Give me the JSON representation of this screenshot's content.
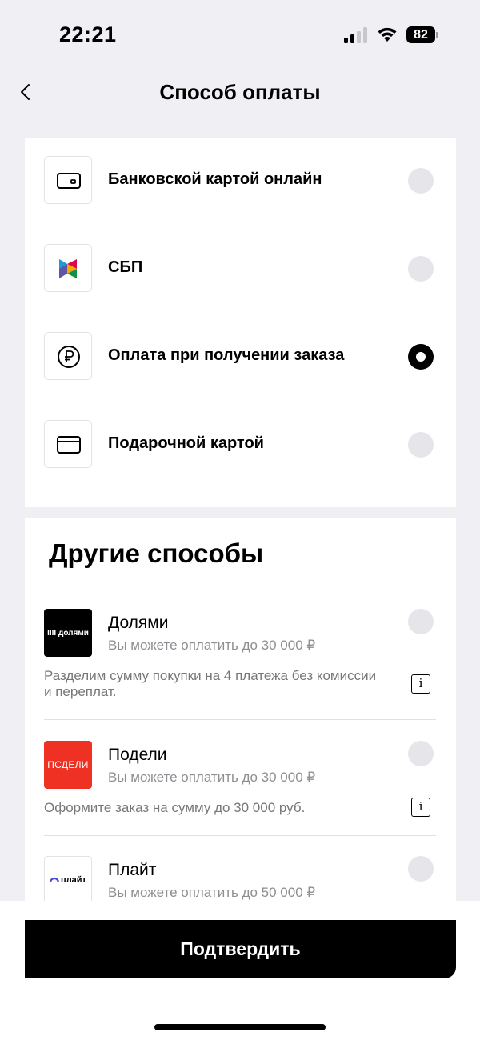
{
  "status_bar": {
    "time": "22:21",
    "battery": "82"
  },
  "nav": {
    "title": "Способ оплаты"
  },
  "payment_methods": [
    {
      "label": "Банковской картой онлайн",
      "icon": "wallet-icon",
      "selected": false
    },
    {
      "label": "СБП",
      "icon": "sbp-logo-icon",
      "selected": false
    },
    {
      "label": "Оплата при получении заказа",
      "icon": "ruble-icon",
      "selected": true
    },
    {
      "label": "Подарочной картой",
      "icon": "gift-card-icon",
      "selected": false
    }
  ],
  "other": {
    "title": "Другие способы",
    "items": [
      {
        "logo_text": "IIII долями",
        "name": "Долями",
        "limit": "Вы можете оплатить до 30 000 ₽",
        "description": "Разделим сумму покупки на 4 платежа без комиссии и переплат.",
        "selected": false
      },
      {
        "logo_text": "ПСДЕЛИ",
        "name": "Подели",
        "limit": "Вы можете оплатить до 30 000 ₽",
        "description": "Оформите заказ на сумму до 30 000 руб.",
        "selected": false
      },
      {
        "logo_text": "плайт",
        "name": "Плайт",
        "limit": "Вы можете оплатить до 50 000 ₽",
        "selected": false
      }
    ],
    "info_label": "i"
  },
  "confirm_button": "Подтвердить",
  "colors": {
    "accent": "#000000",
    "podeli_brand": "#ef3124",
    "background": "#efeff4"
  }
}
